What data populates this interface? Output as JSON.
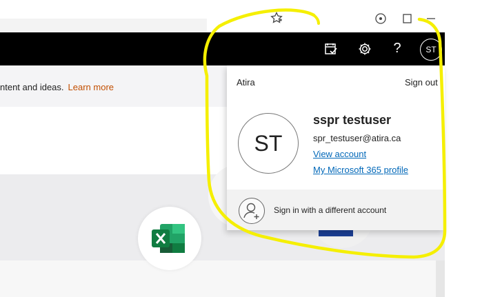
{
  "banner": {
    "text": "ntent and ideas.",
    "link": "Learn more"
  },
  "header": {
    "avatar_initials": "ST",
    "icons": [
      "tasks-icon",
      "settings-icon",
      "help-icon"
    ],
    "help_glyph": "?"
  },
  "account_panel": {
    "tenant": "Atira",
    "sign_out": "Sign out",
    "avatar_initials": "ST",
    "display_name": "sspr testuser",
    "email": "spr_testuser@atira.ca",
    "view_account": "View account",
    "m365_profile": "My Microsoft 365 profile",
    "different_account": "Sign in with a different account"
  },
  "colors": {
    "header_bg": "#000000",
    "link_blue": "#0067b8",
    "learn_more_orange": "#c24e00",
    "highlight_yellow": "#f5ef00",
    "excel_green": "#1e7145"
  }
}
